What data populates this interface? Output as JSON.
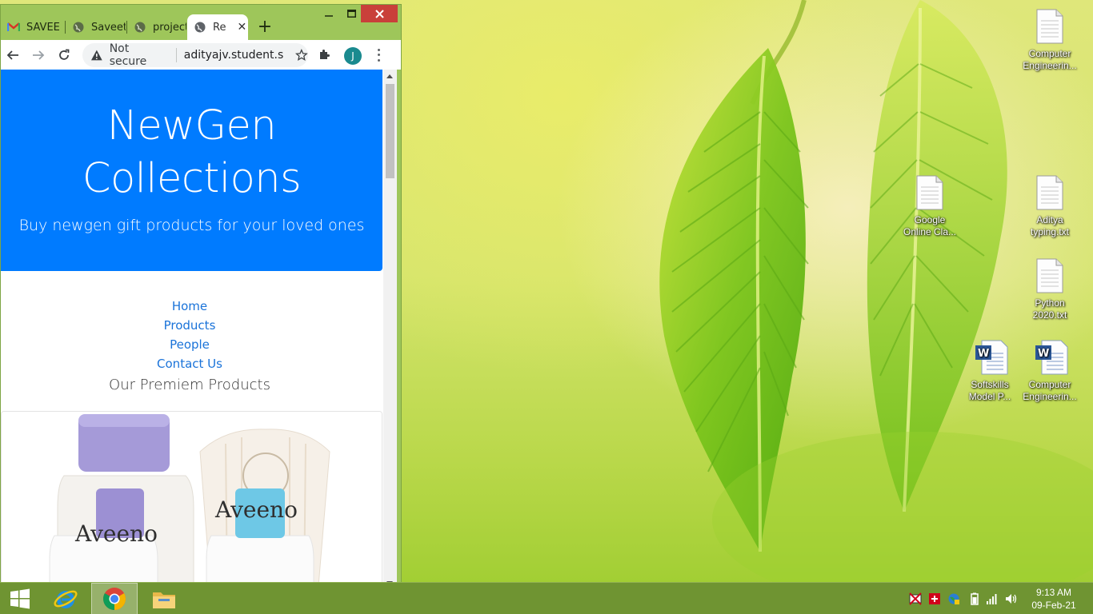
{
  "browser": {
    "tabs": [
      {
        "label": "SAVEE",
        "icon": "gmail-icon"
      },
      {
        "label": "Saveet",
        "icon": "globe-icon"
      },
      {
        "label": "project",
        "icon": "globe-icon"
      },
      {
        "label": "Re",
        "icon": "globe-icon",
        "active": true
      }
    ],
    "new_tab_label": "+",
    "address": {
      "security_label": "Not secure",
      "url": "adityajv.student.sa..."
    },
    "profile_initial": "J"
  },
  "page": {
    "jumbotron": {
      "title_line1": "NewGen",
      "title_line2": "Collections",
      "subtitle": "Buy newgen gift products for your loved ones"
    },
    "nav": [
      "Home",
      "Products",
      "People",
      "Contact Us"
    ],
    "section_title": "Our Premiem Products",
    "product_brand": "Aveeno"
  },
  "desktop_icons": [
    {
      "label_1": "Computer",
      "label_2": "Engineerin...",
      "type": "text-file"
    },
    {
      "label_1": "Google",
      "label_2": "Online Cla...",
      "type": "text-file"
    },
    {
      "label_1": "Aditya",
      "label_2": "typing.txt",
      "type": "text-file"
    },
    {
      "label_1": "Python",
      "label_2": "2020.txt",
      "type": "text-file"
    },
    {
      "label_1": "Softskills",
      "label_2": "Model P...",
      "type": "word-doc"
    },
    {
      "label_1": "Computer",
      "label_2": "Engineerin...",
      "type": "word-doc"
    }
  ],
  "taskbar": {
    "clock_time": "9:13 AM",
    "clock_date": "09-Feb-21"
  },
  "colors": {
    "jumbotron": "#007bff",
    "link": "#1a73d9",
    "taskbar": "#6f9432",
    "close_button": "#c9403a"
  }
}
